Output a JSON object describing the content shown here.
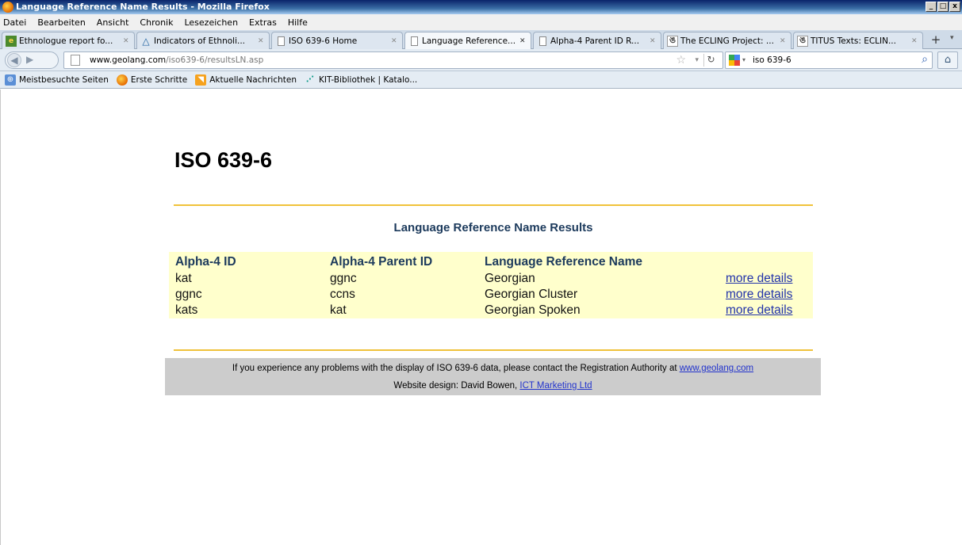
{
  "window": {
    "title": "Language Reference Name Results - Mozilla Firefox",
    "buttons": [
      "_",
      "□",
      "x"
    ]
  },
  "menu": [
    "Datei",
    "Bearbeiten",
    "Ansicht",
    "Chronik",
    "Lesezeichen",
    "Extras",
    "Hilfe"
  ],
  "tabs": [
    {
      "label": "Ethnologue report fo...",
      "icon": "ethnologue-icon"
    },
    {
      "label": "Indicators of Ethnoli...",
      "icon": "ethnologue-triangle-icon"
    },
    {
      "label": "ISO 639-6 Home",
      "icon": "page-icon"
    },
    {
      "label": "Language Reference...",
      "icon": "page-icon",
      "active": true
    },
    {
      "label": "Alpha-4 Parent ID R...",
      "icon": "page-icon"
    },
    {
      "label": "The ECLING Project: ...",
      "icon": "titus-icon"
    },
    {
      "label": "TITUS Texts: ECLIN...",
      "icon": "titus-icon"
    }
  ],
  "nav": {
    "url_domain": "www.geolang.com",
    "url_path": "/iso639-6/resultsLN.asp",
    "search_query": "iso 639-6"
  },
  "bookmarks": [
    "Meistbesuchte Seiten",
    "Erste Schritte",
    "Aktuelle Nachrichten",
    "KIT-Bibliothek | Katalo..."
  ],
  "page": {
    "heading": "ISO 639-6",
    "subtitle": "Language Reference Name Results",
    "columns": [
      "Alpha-4 ID",
      "Alpha-4 Parent ID",
      "Language Reference Name",
      ""
    ],
    "rows": [
      {
        "id": "kat",
        "parent": "ggnc",
        "name": "Georgian",
        "link": "more details"
      },
      {
        "id": "ggnc",
        "parent": "ccns",
        "name": "Georgian Cluster",
        "link": "more details"
      },
      {
        "id": "kats",
        "parent": "kat",
        "name": "Georgian Spoken",
        "link": "more details"
      }
    ],
    "footer": {
      "contact_text": "If you experience any problems with the display of ISO 639-6 data, please contact the Registration Authority at ",
      "contact_link": "www.geolang.com",
      "design_text": "Website design: David Bowen, ",
      "design_link": "ICT Marketing Ltd"
    }
  },
  "colors": {
    "rule": "#f0c23a",
    "table_bg": "#ffffcc",
    "heading_text": "#1c3a5c",
    "footer_bg": "#cccccc",
    "link": "#2233aa"
  }
}
